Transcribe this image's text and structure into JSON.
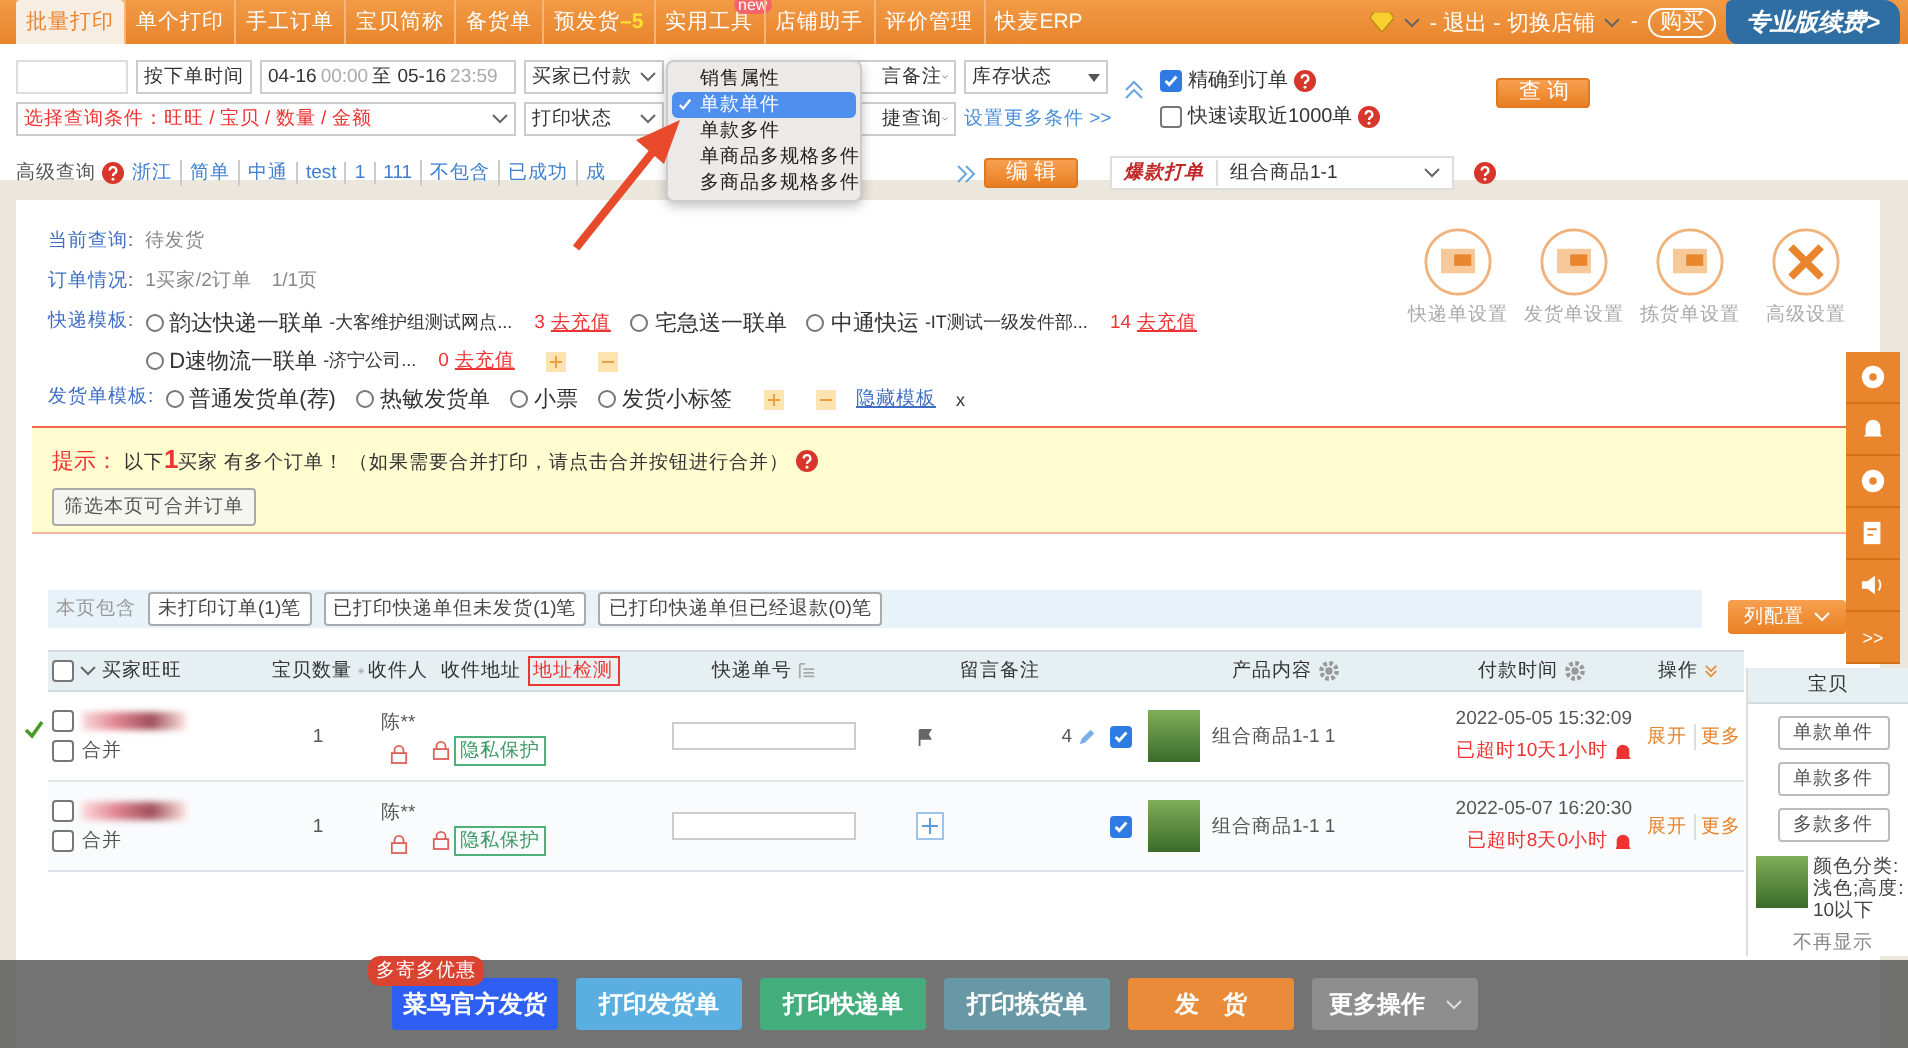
{
  "nav": {
    "tabs": [
      {
        "label": "批量打印",
        "selected": true
      },
      {
        "label": "单个打印",
        "selected": false
      },
      {
        "label": "手工订单",
        "selected": false
      },
      {
        "label": "宝贝简称",
        "selected": false
      },
      {
        "label": "备货单",
        "selected": false
      },
      {
        "label": "预发货",
        "selected": false,
        "badge": "–5"
      },
      {
        "label": "实用工具",
        "selected": false,
        "tag": "new"
      },
      {
        "label": "店铺助手",
        "selected": false
      },
      {
        "label": "评价管理",
        "selected": false
      },
      {
        "label": "快麦ERP",
        "selected": false
      }
    ],
    "account_text": "- 退出 - 切换店铺",
    "sep": "-",
    "buy": "购买",
    "renew": "专业版续费>"
  },
  "filters": {
    "time_type": "按下单时间",
    "date_from": "04-16",
    "time_from": "00:00",
    "date_sep": "至",
    "date_to": "05-16",
    "time_to": "23:59",
    "pay_status": "买家已付款",
    "memo": "言备注",
    "stock": "库存状态",
    "condition": "选择查询条件：旺旺 / 宝贝 / 数量 / 金额",
    "print_status": "打印状态",
    "quick": "捷查询",
    "more": "设置更多条件 >>",
    "options": [
      {
        "label": "精确到订单",
        "checked": true
      },
      {
        "label": "快速读取近1000单",
        "checked": false
      }
    ],
    "query": "查 询"
  },
  "advanced": {
    "label": "高级查询",
    "links": [
      "浙江",
      "简单",
      "中通",
      "test",
      "1",
      "111",
      "不包含",
      "已成功",
      "成"
    ],
    "edit": "编 辑",
    "hot_label": "爆款打单",
    "hot_value": "组合商品1-1"
  },
  "menu": {
    "items": [
      {
        "label": "销售属性",
        "selected": false
      },
      {
        "label": "单款单件",
        "selected": true
      },
      {
        "label": "单款多件",
        "selected": false
      },
      {
        "label": "单商品多规格多件",
        "selected": false
      },
      {
        "label": "多商品多规格多件",
        "selected": false
      }
    ]
  },
  "summary": [
    {
      "label": "当前查询:",
      "value": "待发货"
    },
    {
      "label": "订单情况:",
      "value": "1买家/2订单　1/1页"
    }
  ],
  "express": {
    "label": "快递模板:",
    "templates": [
      {
        "name": "韵达快递一联单",
        "note": "-大客维护组测试网点...",
        "count": "3",
        "recharge": "去充值",
        "selected": false
      },
      {
        "name": "宅急送一联单",
        "selected": false
      },
      {
        "name": "中通快运",
        "note": "-IT测试一级发件部...",
        "count": "14",
        "recharge": "去充值",
        "selected": false
      },
      {
        "name": "D速物流一联单",
        "note": "-济宁公司...",
        "count": "0",
        "recharge": "去充值",
        "selected": false
      }
    ]
  },
  "invoice": {
    "label": "发货单模板:",
    "templates": [
      {
        "name": "普通发货单(荐)",
        "selected": false
      },
      {
        "name": "热敏发货单",
        "selected": false
      },
      {
        "name": "小票",
        "selected": false
      },
      {
        "name": "发货小标签",
        "selected": false
      }
    ],
    "hide": "隐藏模板",
    "close": "x"
  },
  "settings": [
    {
      "label": "快递单设置"
    },
    {
      "label": "发货单设置"
    },
    {
      "label": "拣货单设置"
    },
    {
      "label": "高级设置"
    }
  ],
  "hint": {
    "prefix": "提示：",
    "text": "以下**1**买家 有多个订单！ （如果需要合并打印，请点击合并按钮进行合并）",
    "button": "筛选本页可合并订单"
  },
  "page_filter": {
    "label": "本页包含",
    "buttons": [
      "未打印订单(1)笔",
      "已打印快递单但未发货(1)笔",
      "已打印快递单但已经退款(0)笔"
    ],
    "config": "列配置"
  },
  "table": {
    "select_all": false,
    "columns": [
      "买家旺旺",
      "宝贝数量",
      "收件人",
      "收件地址",
      "地址检测",
      "快递单号",
      "留言备注",
      "产品内容",
      "付款时间",
      "操作"
    ],
    "rows": [
      {
        "marked": true,
        "selected": false,
        "merge": "合并",
        "merge_checked": false,
        "qty": "1",
        "recipient": "陈**",
        "privacy": "隐私保护",
        "memo_count": "4",
        "product_checked": true,
        "product": "组合商品1-1 1",
        "paid": "2022-05-05 15:32:09",
        "overdue": "已超时10天1小时",
        "actions": [
          "展开",
          "更多"
        ]
      },
      {
        "marked": false,
        "selected": false,
        "merge": "合并",
        "merge_checked": false,
        "qty": "1",
        "recipient": "陈**",
        "privacy": "隐私保护",
        "product_checked": true,
        "product": "组合商品1-1 1",
        "paid": "2022-05-07 16:20:30",
        "overdue": "已超时8天0小时",
        "actions": [
          "展开",
          "更多"
        ]
      }
    ]
  },
  "side_panel": {
    "title": "宝贝",
    "buttons": [
      "单款单件",
      "单款多件",
      "多款多件"
    ],
    "sku": "颜色分类:浅色;高度:10以下",
    "dismiss": "不再显示"
  },
  "side_toolbar": {
    "collapse": ">>"
  },
  "bottom": {
    "promo": "多寄多优惠",
    "buttons": [
      {
        "label": "菜鸟官方发货",
        "color": "#2f5ff2"
      },
      {
        "label": "打印发货单",
        "color": "#5aaee0"
      },
      {
        "label": "打印快递单",
        "color": "#44ad7c"
      },
      {
        "label": "打印拣货单",
        "color": "#6898a6"
      },
      {
        "label": "发　货",
        "color": "#e98b39"
      },
      {
        "label": "更多操作",
        "color": "#8e8e8e",
        "caret": true
      }
    ]
  }
}
